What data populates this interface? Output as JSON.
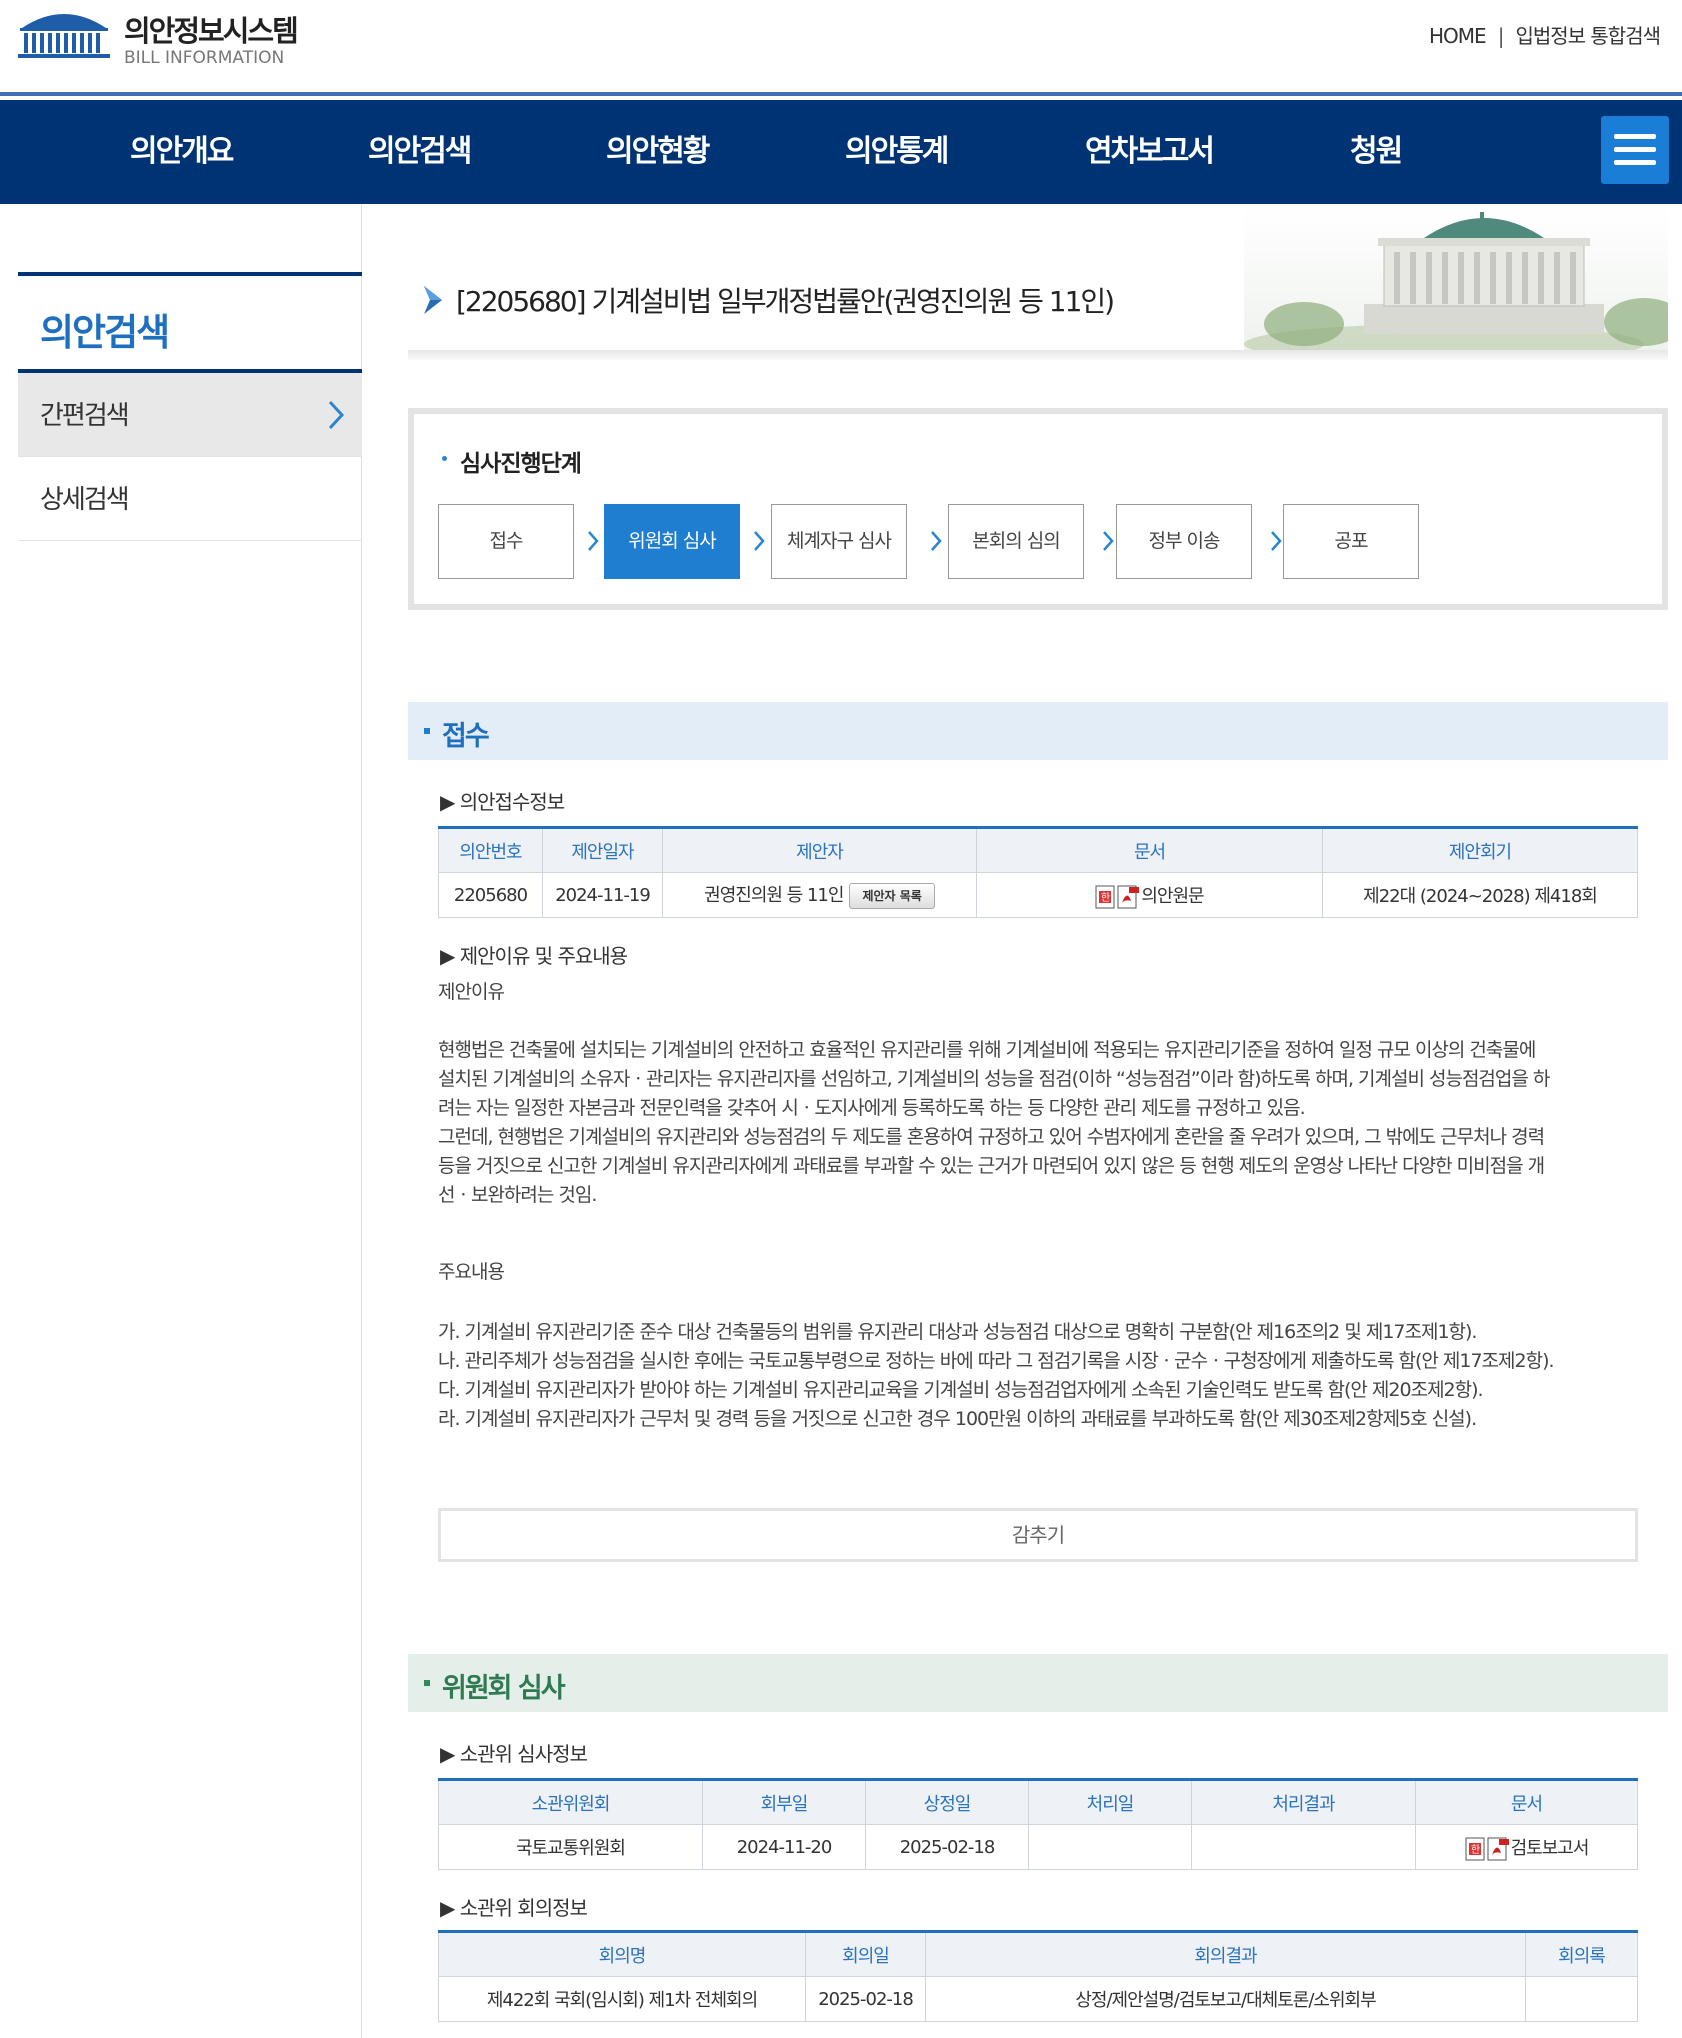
{
  "header": {
    "logo_title": "의안정보시스템",
    "logo_sub": "BILL INFORMATION",
    "util_home": "HOME",
    "util_sep": "|",
    "util_search": "입법정보 통합검색"
  },
  "gnb": [
    "의안개요",
    "의안검색",
    "의안현황",
    "의안통계",
    "연차보고서",
    "청원"
  ],
  "lnb": {
    "title": "의안검색",
    "items": [
      "간편검색",
      "상세검색"
    ]
  },
  "page_title": "[2205680] 기계설비법 일부개정법률안(권영진의원 등 11인)",
  "stages": {
    "title": "심사진행단계",
    "items": [
      "접수",
      "위원회 심사",
      "체계자구 심사",
      "본회의 심의",
      "정부 이송",
      "공포"
    ],
    "active_index": 1
  },
  "receipt": {
    "title": "접수",
    "info_title": "▶ 의안접수정보",
    "headers": [
      "의안번호",
      "제안일자",
      "제안자",
      "문서",
      "제안회기"
    ],
    "row": {
      "bill_no": "2205680",
      "date": "2024-11-19",
      "proposer": "권영진의원 등 11인",
      "proposer_btn": "제안자 목록",
      "doc": "의안원문",
      "session": "제22대 (2024~2028) 제418회"
    },
    "reason_title": "▶ 제안이유 및 주요내용",
    "reason_label": "제안이유",
    "reason_lines": [
      "현행법은 건축물에 설치되는 기계설비의 안전하고 효율적인 유지관리를 위해 기계설비에 적용되는 유지관리기준을 정하여 일정 규모 이상의 건축물에",
      "설치된 기계설비의 소유자ㆍ관리자는 유지관리자를 선임하고, 기계설비의 성능을 점검(이하 “성능점검”이라 함)하도록 하며, 기계설비 성능점검업을 하",
      "려는 자는 일정한 자본금과 전문인력을 갖추어 시ㆍ도지사에게 등록하도록 하는 등 다양한 관리 제도를 규정하고 있음.",
      "그런데, 현행법은 기계설비의 유지관리와 성능점검의 두 제도를 혼용하여 규정하고 있어 수범자에게 혼란을 줄 우려가 있으며, 그 밖에도 근무처나 경력",
      "등을 거짓으로 신고한 기계설비 유지관리자에게 과태료를 부과할 수 있는 근거가 마련되어 있지 않은 등 현행 제도의 운영상 나타난 다양한 미비점을 개",
      "선ㆍ보완하려는 것임."
    ],
    "main_label": "주요내용",
    "main_lines": [
      "가. 기계설비 유지관리기준 준수 대상 건축물등의 범위를 유지관리 대상과 성능점검 대상으로 명확히 구분함(안 제16조의2 및 제17조제1항).",
      "나. 관리주체가 성능점검을 실시한 후에는 국토교통부령으로 정하는 바에 따라 그 점검기록을 시장ㆍ군수ㆍ구청장에게 제출하도록 함(안 제17조제2항).",
      "다. 기계설비 유지관리자가 받아야 하는 기계설비 유지관리교육을 기계설비 성능점검업자에게 소속된 기술인력도 받도록 함(안 제20조제2항).",
      "라. 기계설비 유지관리자가 근무처 및 경력 등을 거짓으로 신고한 경우 100만원 이하의 과태료를 부과하도록 함(안 제30조제2항제5호 신설)."
    ],
    "hide_btn": "감추기"
  },
  "committee": {
    "title": "위원회 심사",
    "info_title": "▶ 소관위 심사정보",
    "headers": [
      "소관위원회",
      "회부일",
      "상정일",
      "처리일",
      "처리결과",
      "문서"
    ],
    "row": [
      "국토교통위원회",
      "2024-11-20",
      "2025-02-18",
      "",
      "",
      "검토보고서"
    ],
    "meeting_title": "▶ 소관위 회의정보",
    "meeting_headers": [
      "회의명",
      "회의일",
      "회의결과",
      "회의록"
    ],
    "meeting_row": [
      "제422회 국회(임시회) 제1차 전체회의",
      "2025-02-18",
      "상정/제안설명/검토보고/대체토론/소위회부",
      ""
    ]
  },
  "colors": {
    "gnb_bg": "#003374",
    "accent": "#1f7ed0",
    "receipt_bar": "#e3edf7",
    "committee_bar": "#e5efe9"
  }
}
